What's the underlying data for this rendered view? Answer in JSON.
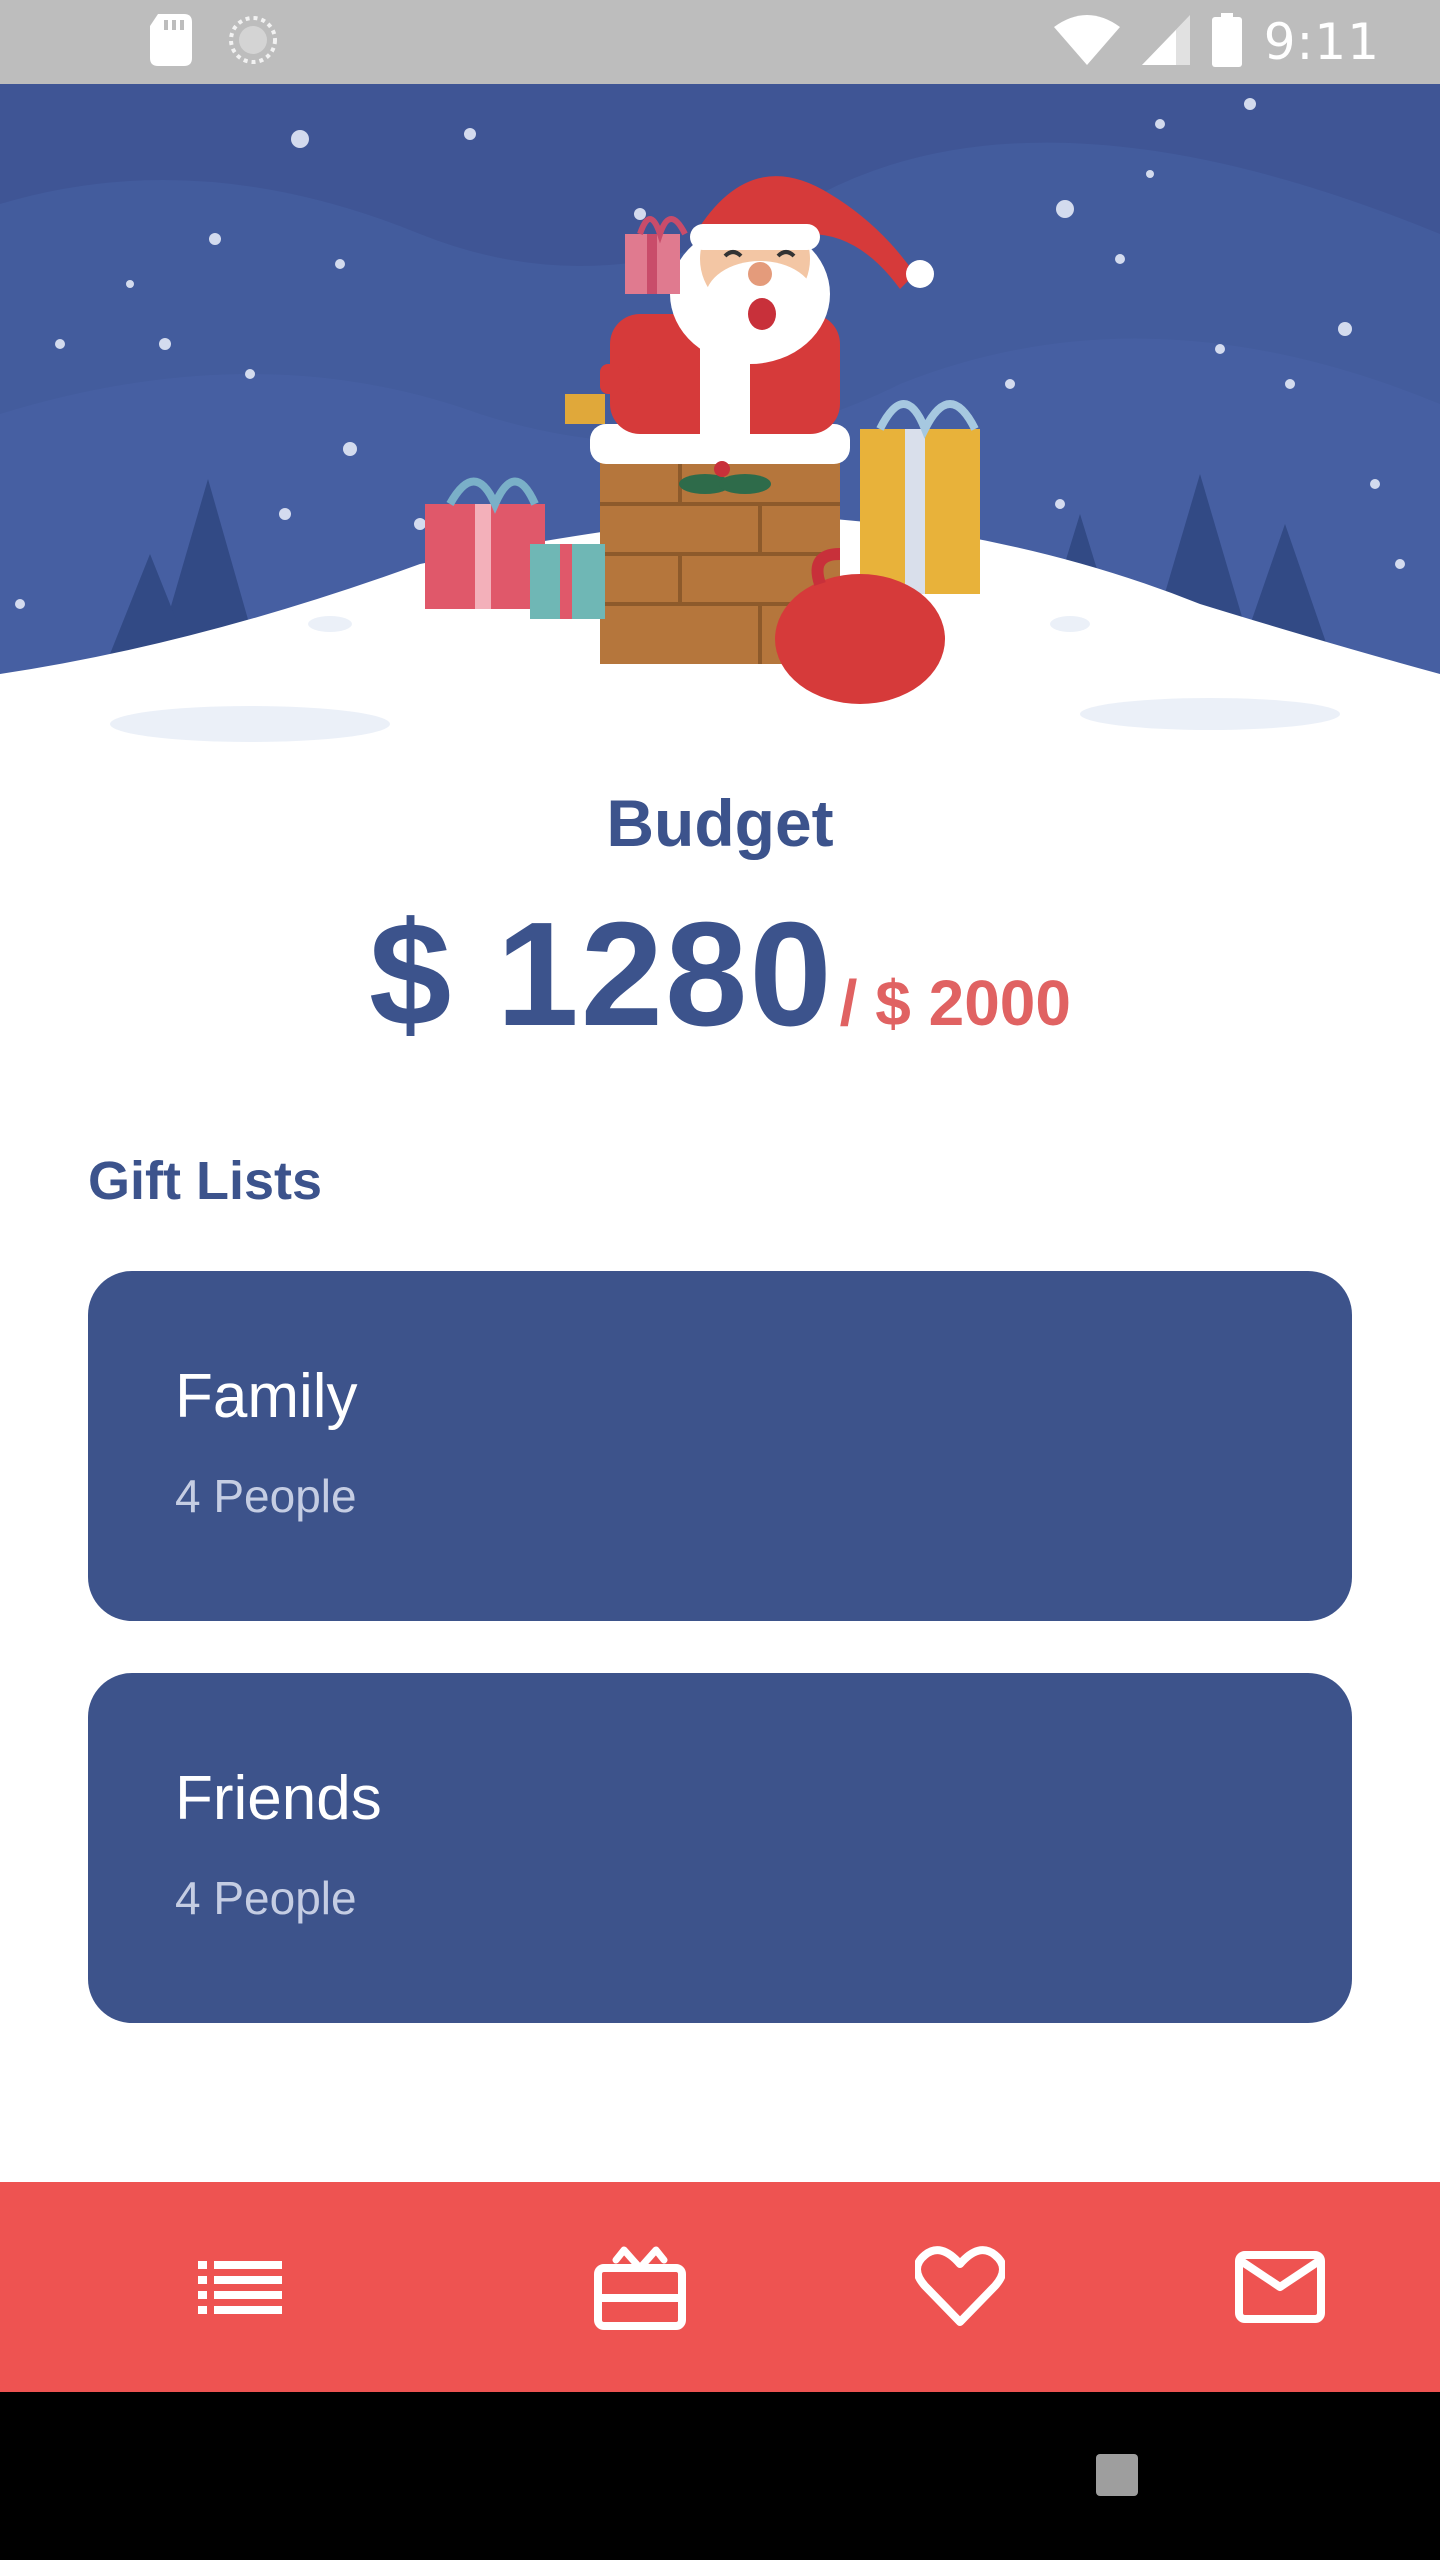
{
  "status_bar": {
    "time": "9:11",
    "icons": [
      "sd-card-icon",
      "loading-icon",
      "wifi-icon",
      "signal-icon",
      "battery-icon"
    ]
  },
  "hero": {
    "illustration": "santa-chimney-illustration",
    "colors": {
      "sky": "#3f5595",
      "snow": "#ffffff"
    }
  },
  "budget": {
    "title": "Budget",
    "spent": "$ 1280",
    "total": "/ $ 2000"
  },
  "gift_lists": {
    "title": "Gift Lists",
    "items": [
      {
        "name": "Family",
        "count": "4 People"
      },
      {
        "name": "Friends",
        "count": "4 People"
      }
    ]
  },
  "bottom_nav": {
    "items": [
      {
        "icon": "list-icon"
      },
      {
        "icon": "gift-icon"
      },
      {
        "icon": "heart-icon"
      },
      {
        "icon": "mail-icon"
      }
    ]
  },
  "colors": {
    "primary": "#3d538b",
    "accent": "#ee5351",
    "budget_total": "#e06262",
    "card_subtext": "#c5cde3"
  }
}
